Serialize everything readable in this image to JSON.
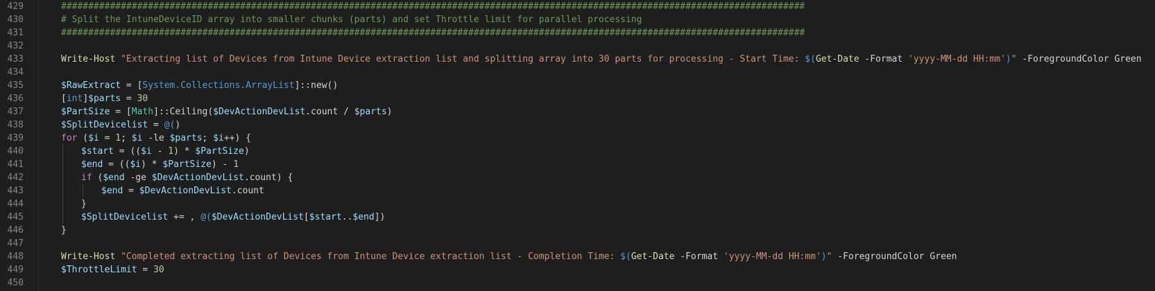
{
  "editor": {
    "lines": [
      {
        "number": "429",
        "indent": 0,
        "tokens": [
          {
            "t": "comment",
            "v": "#########################################################################################################################################"
          }
        ]
      },
      {
        "number": "430",
        "indent": 0,
        "tokens": [
          {
            "t": "comment",
            "v": "# Split the IntuneDeviceID array into smaller chunks (parts) and set Throttle limit for parallel processing"
          }
        ]
      },
      {
        "number": "431",
        "indent": 0,
        "tokens": [
          {
            "t": "comment",
            "v": "#########################################################################################################################################"
          }
        ]
      },
      {
        "number": "432",
        "indent": 0,
        "tokens": []
      },
      {
        "number": "433",
        "indent": 0,
        "tokens": [
          {
            "t": "cmdlet",
            "v": "Write-Host"
          },
          {
            "t": "plain",
            "v": " "
          },
          {
            "t": "string",
            "v": "\"Extracting list of Devices from Intune Device extraction list and splitting array into 30 parts for processing - Start Time: "
          },
          {
            "t": "subexpr",
            "v": "$("
          },
          {
            "t": "cmdlet",
            "v": "Get-Date"
          },
          {
            "t": "plain",
            "v": " -Format "
          },
          {
            "t": "string",
            "v": "'yyyy-MM-dd HH:mm'"
          },
          {
            "t": "subexpr",
            "v": ")"
          },
          {
            "t": "string",
            "v": "\""
          },
          {
            "t": "plain",
            "v": " -ForegroundColor Green"
          }
        ]
      },
      {
        "number": "434",
        "indent": 0,
        "tokens": []
      },
      {
        "number": "435",
        "indent": 0,
        "tokens": [
          {
            "t": "variable",
            "v": "$RawExtract"
          },
          {
            "t": "plain",
            "v": " = ["
          },
          {
            "t": "subexpr",
            "v": "System.Collections.ArrayList"
          },
          {
            "t": "plain",
            "v": "]::new()"
          }
        ]
      },
      {
        "number": "436",
        "indent": 0,
        "tokens": [
          {
            "t": "plain",
            "v": "["
          },
          {
            "t": "subexpr",
            "v": "int"
          },
          {
            "t": "plain",
            "v": "]"
          },
          {
            "t": "variable",
            "v": "$parts"
          },
          {
            "t": "plain",
            "v": " = "
          },
          {
            "t": "number",
            "v": "30"
          }
        ]
      },
      {
        "number": "437",
        "indent": 0,
        "tokens": [
          {
            "t": "variable",
            "v": "$PartSize"
          },
          {
            "t": "plain",
            "v": " = ["
          },
          {
            "t": "type",
            "v": "Math"
          },
          {
            "t": "plain",
            "v": "]::Ceiling("
          },
          {
            "t": "variable",
            "v": "$DevActionDevList"
          },
          {
            "t": "plain",
            "v": ".count / "
          },
          {
            "t": "variable",
            "v": "$parts"
          },
          {
            "t": "plain",
            "v": ")"
          }
        ]
      },
      {
        "number": "438",
        "indent": 0,
        "tokens": [
          {
            "t": "variable",
            "v": "$SplitDevicelist"
          },
          {
            "t": "plain",
            "v": " = "
          },
          {
            "t": "subexpr",
            "v": "@("
          },
          {
            "t": "plain",
            "v": ")"
          }
        ]
      },
      {
        "number": "439",
        "indent": 0,
        "tokens": [
          {
            "t": "keyword",
            "v": "for"
          },
          {
            "t": "plain",
            "v": " ("
          },
          {
            "t": "variable",
            "v": "$i"
          },
          {
            "t": "plain",
            "v": " = "
          },
          {
            "t": "number",
            "v": "1"
          },
          {
            "t": "plain",
            "v": "; "
          },
          {
            "t": "variable",
            "v": "$i"
          },
          {
            "t": "plain",
            "v": " -le "
          },
          {
            "t": "variable",
            "v": "$parts"
          },
          {
            "t": "plain",
            "v": "; "
          },
          {
            "t": "variable",
            "v": "$i"
          },
          {
            "t": "plain",
            "v": "++) {"
          }
        ]
      },
      {
        "number": "440",
        "indent": 1,
        "tokens": [
          {
            "t": "variable",
            "v": "$start"
          },
          {
            "t": "plain",
            "v": " = (("
          },
          {
            "t": "variable",
            "v": "$i"
          },
          {
            "t": "plain",
            "v": " - "
          },
          {
            "t": "number",
            "v": "1"
          },
          {
            "t": "plain",
            "v": ") * "
          },
          {
            "t": "variable",
            "v": "$PartSize"
          },
          {
            "t": "plain",
            "v": ")"
          }
        ]
      },
      {
        "number": "441",
        "indent": 1,
        "tokens": [
          {
            "t": "variable",
            "v": "$end"
          },
          {
            "t": "plain",
            "v": " = (("
          },
          {
            "t": "variable",
            "v": "$i"
          },
          {
            "t": "plain",
            "v": ") * "
          },
          {
            "t": "variable",
            "v": "$PartSize"
          },
          {
            "t": "plain",
            "v": ") - "
          },
          {
            "t": "number",
            "v": "1"
          }
        ]
      },
      {
        "number": "442",
        "indent": 1,
        "tokens": [
          {
            "t": "keyword",
            "v": "if"
          },
          {
            "t": "plain",
            "v": " ("
          },
          {
            "t": "variable",
            "v": "$end"
          },
          {
            "t": "plain",
            "v": " -ge "
          },
          {
            "t": "variable",
            "v": "$DevActionDevList"
          },
          {
            "t": "plain",
            "v": ".count) {"
          }
        ]
      },
      {
        "number": "443",
        "indent": 2,
        "tokens": [
          {
            "t": "variable",
            "v": "$end"
          },
          {
            "t": "plain",
            "v": " = "
          },
          {
            "t": "variable",
            "v": "$DevActionDevList"
          },
          {
            "t": "plain",
            "v": ".count"
          }
        ]
      },
      {
        "number": "444",
        "indent": 1,
        "tokens": [
          {
            "t": "plain",
            "v": "}"
          }
        ]
      },
      {
        "number": "445",
        "indent": 1,
        "tokens": [
          {
            "t": "variable",
            "v": "$SplitDevicelist"
          },
          {
            "t": "plain",
            "v": " += , "
          },
          {
            "t": "subexpr",
            "v": "@("
          },
          {
            "t": "variable",
            "v": "$DevActionDevList"
          },
          {
            "t": "plain",
            "v": "["
          },
          {
            "t": "variable",
            "v": "$start"
          },
          {
            "t": "plain",
            "v": ".."
          },
          {
            "t": "variable",
            "v": "$end"
          },
          {
            "t": "plain",
            "v": "])"
          }
        ]
      },
      {
        "number": "446",
        "indent": 0,
        "tokens": [
          {
            "t": "plain",
            "v": "}"
          }
        ]
      },
      {
        "number": "447",
        "indent": 0,
        "tokens": []
      },
      {
        "number": "448",
        "indent": 0,
        "tokens": [
          {
            "t": "cmdlet",
            "v": "Write-Host"
          },
          {
            "t": "plain",
            "v": " "
          },
          {
            "t": "string",
            "v": "\"Completed extracting list of Devices from Intune Device extraction list - Completion Time: "
          },
          {
            "t": "subexpr",
            "v": "$("
          },
          {
            "t": "cmdlet",
            "v": "Get-Date"
          },
          {
            "t": "plain",
            "v": " -Format "
          },
          {
            "t": "string",
            "v": "'yyyy-MM-dd HH:mm'"
          },
          {
            "t": "subexpr",
            "v": ")"
          },
          {
            "t": "string",
            "v": "\""
          },
          {
            "t": "plain",
            "v": " -ForegroundColor Green"
          }
        ]
      },
      {
        "number": "449",
        "indent": 0,
        "tokens": [
          {
            "t": "variable",
            "v": "$ThrottleLimit"
          },
          {
            "t": "plain",
            "v": " = "
          },
          {
            "t": "number",
            "v": "30"
          }
        ]
      },
      {
        "number": "450",
        "indent": 0,
        "tokens": []
      }
    ]
  }
}
